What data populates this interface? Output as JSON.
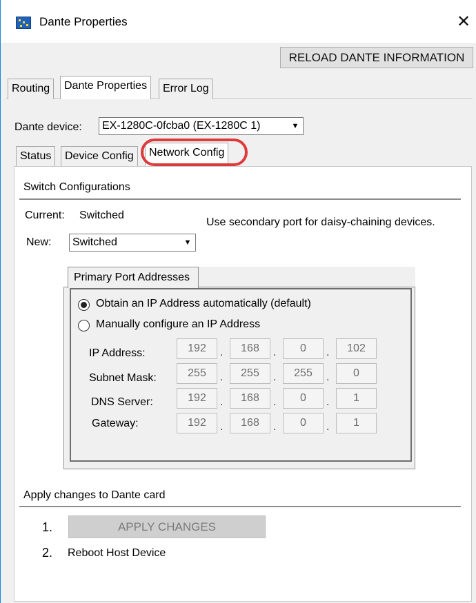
{
  "window": {
    "title": "Dante Properties",
    "close_glyph": "✕",
    "icon": "dante-app-icon"
  },
  "toolbar": {
    "reload_label": "RELOAD DANTE INFORMATION"
  },
  "top_tabs": [
    {
      "label": "Routing",
      "active": false
    },
    {
      "label": "Dante Properties",
      "active": true
    },
    {
      "label": "Error Log",
      "active": false
    }
  ],
  "device": {
    "label": "Dante device:",
    "selected": "EX-1280C-0fcba0 (EX-1280C 1)",
    "arrow": "▼"
  },
  "sub_tabs": [
    {
      "label": "Status",
      "active": false
    },
    {
      "label": "Device Config",
      "active": false
    },
    {
      "label": "Network Config",
      "active": true
    }
  ],
  "switch_config": {
    "title": "Switch Configurations",
    "current_label": "Current:",
    "current_value": "Switched",
    "hint": "Use secondary port for daisy-chaining devices.",
    "new_label": "New:",
    "new_value": "Switched",
    "arrow": "▼"
  },
  "primary_port": {
    "tab_label": "Primary Port Addresses",
    "radio_auto": "Obtain an IP Address automatically (default)",
    "radio_manual": "Manually configure an IP Address",
    "selected": "auto",
    "fields": [
      {
        "label": "IP Address:",
        "octets": [
          "192",
          "168",
          "0",
          "102"
        ]
      },
      {
        "label": "Subnet Mask:",
        "octets": [
          "255",
          "255",
          "255",
          "0"
        ]
      },
      {
        "label": "DNS Server:",
        "octets": [
          "192",
          "168",
          "0",
          "1"
        ]
      },
      {
        "label": "Gateway:",
        "octets": [
          "192",
          "168",
          "0",
          "1"
        ]
      }
    ],
    "separator": "."
  },
  "apply": {
    "title": "Apply changes to Dante card",
    "step1_num": "1.",
    "apply_label": "APPLY CHANGES",
    "step2_num": "2.",
    "step2_text": "Reboot Host Device"
  },
  "colors": {
    "highlight_ring": "#dd3a3c",
    "window_border": "#1883d7"
  }
}
